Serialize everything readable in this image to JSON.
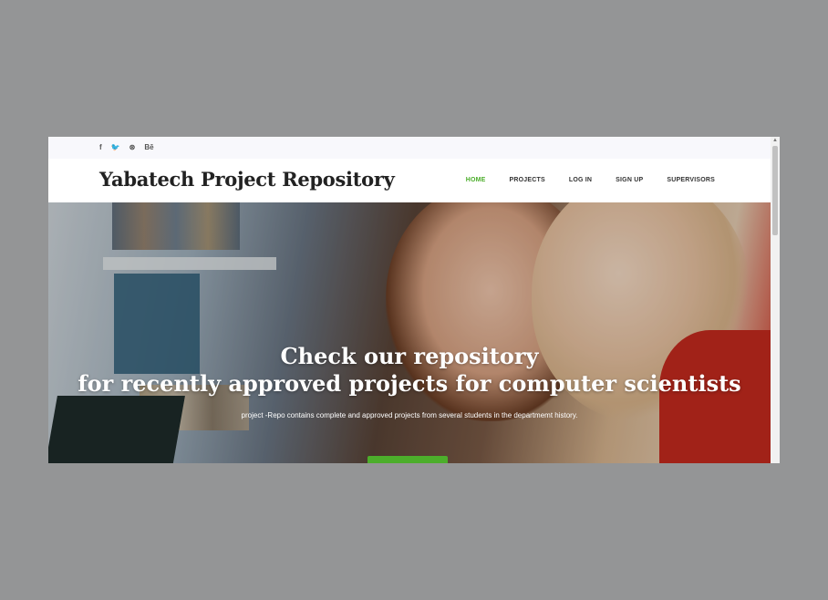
{
  "topbar": {
    "social": [
      {
        "icon": "facebook-icon",
        "glyph": "f"
      },
      {
        "icon": "twitter-icon",
        "glyph": "🐦"
      },
      {
        "icon": "dribbble-icon",
        "glyph": "⊛"
      },
      {
        "icon": "behance-icon",
        "glyph": "Bē"
      }
    ]
  },
  "navbar": {
    "brand": "Yabatech Project Repository",
    "links": [
      "HOME",
      "PROJECTS",
      "LOG IN",
      "SIGN UP",
      "SUPERVISORS"
    ],
    "active_color": "#4cae2b"
  },
  "hero": {
    "headline_line1": "Check our repository",
    "headline_line2": "for recently approved projects for computer scientists",
    "subtext": "project -Repo contains complete and approved projects from several students in the departmemt history.",
    "cta_color": "#4cae2b"
  }
}
